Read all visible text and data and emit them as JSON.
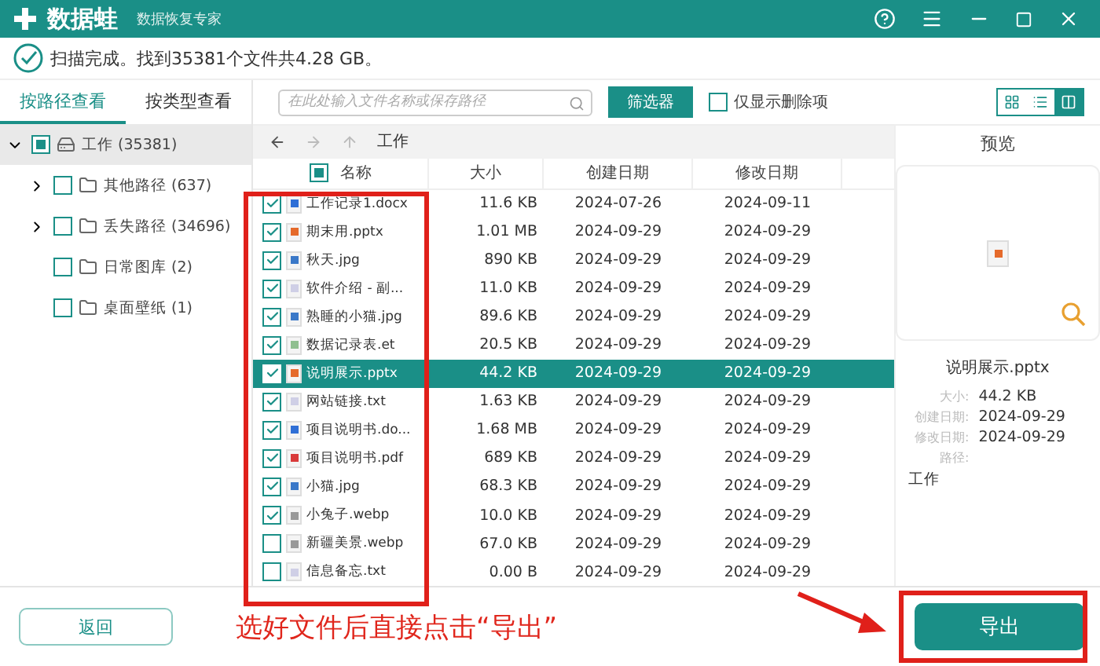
{
  "window": {
    "app_name": "数据蛙",
    "subtitle": "数据恢复专家"
  },
  "status": "扫描完成。找到35381个文件共4.28 GB。",
  "view_tabs": [
    {
      "label": "按路径查看",
      "selected": true
    },
    {
      "label": "按类型查看",
      "selected": false
    }
  ],
  "tree": [
    {
      "label": "工作 (35381)",
      "expanded": true,
      "checked": false,
      "partial": true,
      "selected": true,
      "kind": "drive",
      "children": [
        {
          "label": "其他路径 (637)",
          "expanded": false,
          "checked": false,
          "selected": false,
          "kind": "folder",
          "has_children": true
        },
        {
          "label": "丢失路径 (34696)",
          "expanded": false,
          "checked": false,
          "selected": false,
          "kind": "folder",
          "has_children": true
        },
        {
          "label": "日常图库 (2)",
          "expanded": false,
          "checked": false,
          "selected": false,
          "kind": "folder",
          "has_children": false
        },
        {
          "label": "桌面壁纸 (1)",
          "expanded": false,
          "checked": false,
          "selected": false,
          "kind": "folder",
          "has_children": false
        }
      ]
    }
  ],
  "search": {
    "placeholder": "在此处输入文件名称或保存路径"
  },
  "filter_button": "筛选器",
  "deleted_only": {
    "label": "仅显示删除项",
    "checked": false
  },
  "view_modes": [
    {
      "kind": "grid",
      "selected": false
    },
    {
      "kind": "list",
      "selected": false
    },
    {
      "kind": "preview",
      "selected": true
    }
  ],
  "path": "工作",
  "table": {
    "header_checkbox": {
      "partial": true
    },
    "columns": [
      "名称",
      "大小",
      "创建日期",
      "修改日期"
    ],
    "rows": [
      {
        "name": "工作记录1.docx",
        "kind": "doc",
        "size": "11.6 KB",
        "created": "2024-07-26",
        "modified": "2024-09-11",
        "checked": true,
        "selected": false
      },
      {
        "name": "期末用.pptx",
        "kind": "ppt",
        "size": "1.01 MB",
        "created": "2024-09-29",
        "modified": "2024-09-29",
        "checked": true,
        "selected": false
      },
      {
        "name": "秋天.jpg",
        "kind": "img",
        "size": "890 KB",
        "created": "2024-09-29",
        "modified": "2024-09-29",
        "checked": true,
        "selected": false
      },
      {
        "name": "软件介绍 - 副...",
        "kind": "txt",
        "size": "11.0 KB",
        "created": "2024-09-29",
        "modified": "2024-09-29",
        "checked": true,
        "selected": false
      },
      {
        "name": "熟睡的小猫.jpg",
        "kind": "img",
        "size": "89.6 KB",
        "created": "2024-09-29",
        "modified": "2024-09-29",
        "checked": true,
        "selected": false
      },
      {
        "name": "数据记录表.et",
        "kind": "sheet",
        "size": "20.5 KB",
        "created": "2024-09-29",
        "modified": "2024-09-29",
        "checked": true,
        "selected": false
      },
      {
        "name": "说明展示.pptx",
        "kind": "ppt",
        "size": "44.2 KB",
        "created": "2024-09-29",
        "modified": "2024-09-29",
        "checked": true,
        "selected": true
      },
      {
        "name": "网站链接.txt",
        "kind": "txt",
        "size": "1.63 KB",
        "created": "2024-09-29",
        "modified": "2024-09-29",
        "checked": true,
        "selected": false
      },
      {
        "name": "项目说明书.do...",
        "kind": "doc",
        "size": "1.68 MB",
        "created": "2024-09-29",
        "modified": "2024-09-29",
        "checked": true,
        "selected": false
      },
      {
        "name": "项目说明书.pdf",
        "kind": "pdf",
        "size": "689 KB",
        "created": "2024-09-29",
        "modified": "2024-09-29",
        "checked": true,
        "selected": false
      },
      {
        "name": "小猫.jpg",
        "kind": "img",
        "size": "68.3 KB",
        "created": "2024-09-29",
        "modified": "2024-09-29",
        "checked": true,
        "selected": false
      },
      {
        "name": "小兔子.webp",
        "kind": "webp",
        "size": "10.0 KB",
        "created": "2024-09-29",
        "modified": "2024-09-29",
        "checked": true,
        "selected": false
      },
      {
        "name": "新疆美景.webp",
        "kind": "webp",
        "size": "67.0 KB",
        "created": "2024-09-29",
        "modified": "2024-09-29",
        "checked": false,
        "selected": false
      },
      {
        "name": "信息备忘.txt",
        "kind": "txt",
        "size": "0.00 B",
        "created": "2024-09-29",
        "modified": "2024-09-29",
        "checked": false,
        "selected": false
      }
    ]
  },
  "preview": {
    "title": "预览",
    "kind": "ppt",
    "file_name": "说明展示.pptx",
    "details": [
      {
        "label": "大小:",
        "value": "44.2 KB"
      },
      {
        "label": "创建日期:",
        "value": "2024-09-29"
      },
      {
        "label": "修改日期:",
        "value": "2024-09-29"
      },
      {
        "label": "路径:"
      }
    ],
    "path_value": "工作"
  },
  "buttons": {
    "back": "返回",
    "export": "导出"
  },
  "annotation": {
    "text": "选好文件后直接点击“导出”"
  }
}
